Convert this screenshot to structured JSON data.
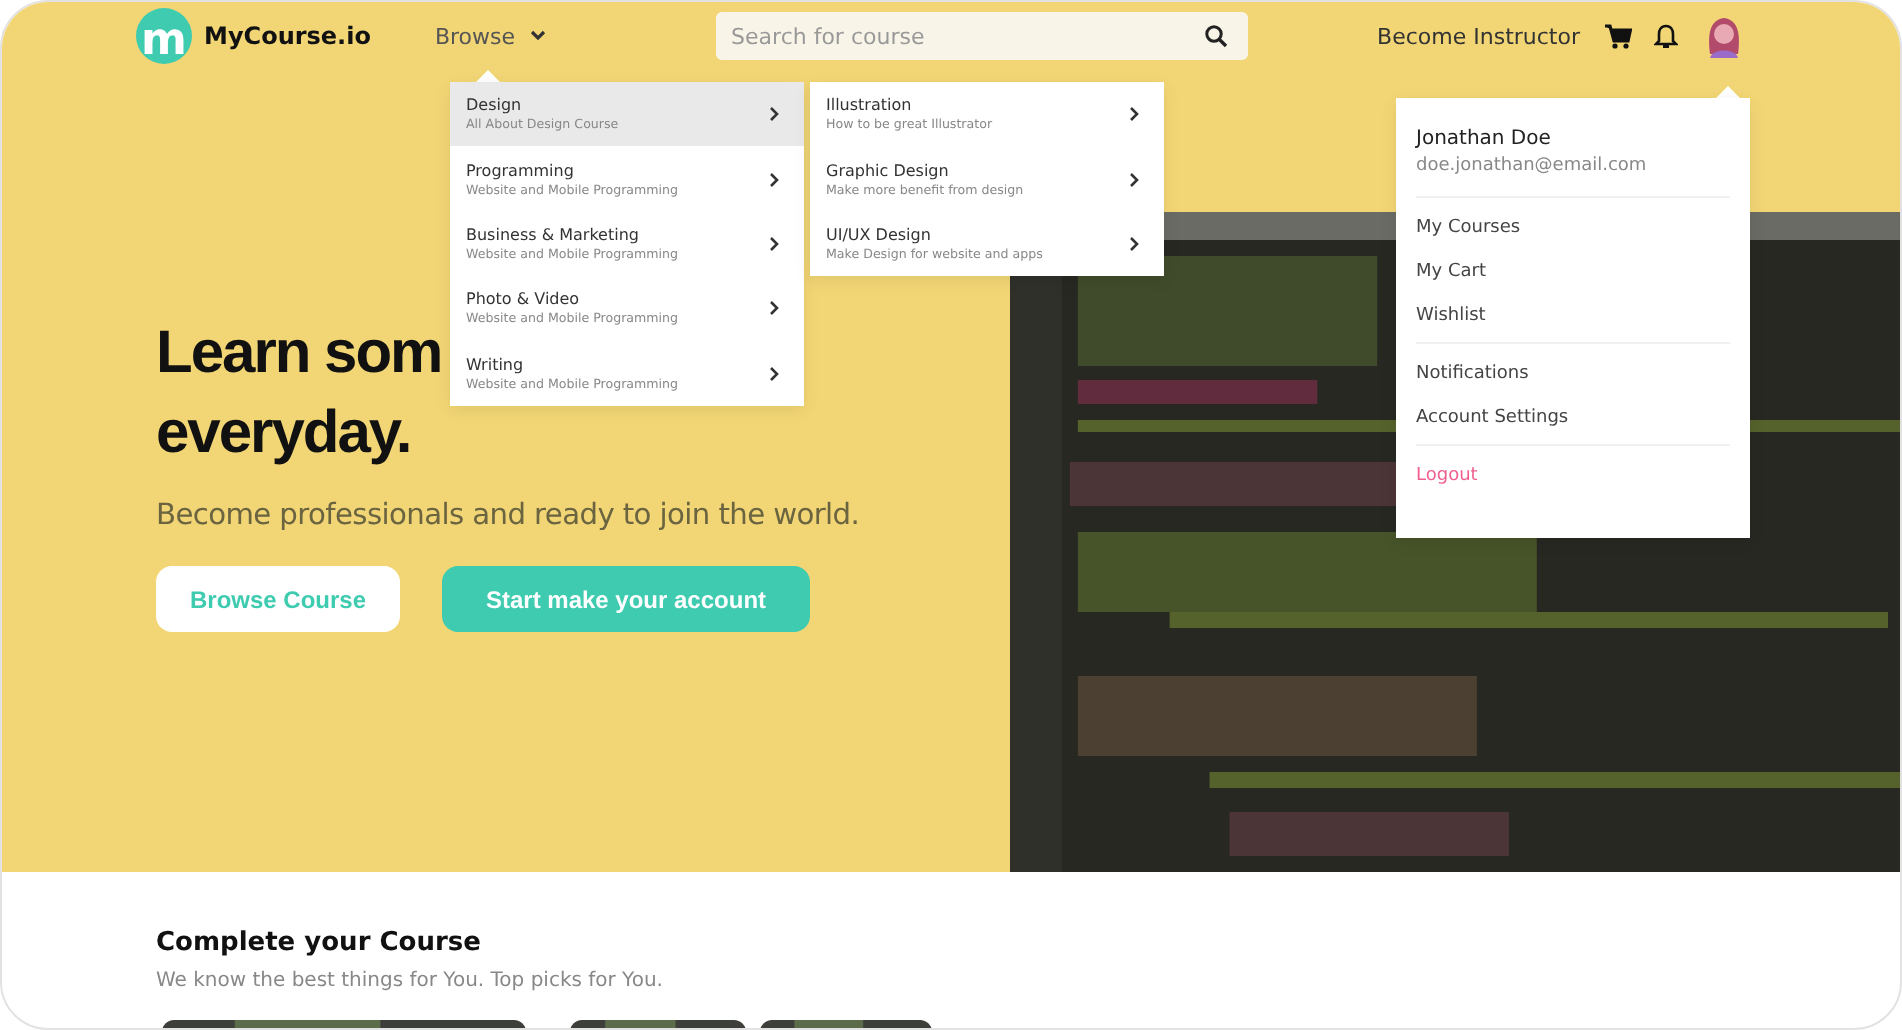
{
  "header": {
    "logo_mark": "m",
    "brand": "MyCourse.io",
    "browse": "Browse",
    "search": {
      "placeholder": "Search for course"
    },
    "become_instructor": "Become Instructor"
  },
  "browse_menu": [
    {
      "title": "Design",
      "subtitle": "All About Design Course",
      "selected": true
    },
    {
      "title": "Programming",
      "subtitle": "Website and Mobile Programming",
      "selected": false
    },
    {
      "title": "Business & Marketing",
      "subtitle": "Website and Mobile Programming",
      "selected": false
    },
    {
      "title": "Photo & Video",
      "subtitle": "Website and Mobile Programming",
      "selected": false
    },
    {
      "title": "Writing",
      "subtitle": "Website and Mobile Programming",
      "selected": false
    }
  ],
  "submenu": [
    {
      "title": "Illustration",
      "subtitle": "How to be great Illustrator"
    },
    {
      "title": "Graphic Design",
      "subtitle": "Make more benefit from design"
    },
    {
      "title": "UI/UX Design",
      "subtitle": "Make Design for website and apps"
    }
  ],
  "profile_menu": {
    "name": "Jonathan Doe",
    "email": "doe.jonathan@email.com",
    "groups": [
      [
        {
          "label": "My Courses",
          "kind": "normal"
        },
        {
          "label": "My Cart",
          "kind": "normal"
        },
        {
          "label": "Wishlist",
          "kind": "normal"
        }
      ],
      [
        {
          "label": "Notifications",
          "kind": "normal"
        },
        {
          "label": "Account Settings",
          "kind": "normal"
        }
      ],
      [
        {
          "label": "Logout",
          "kind": "danger"
        }
      ]
    ]
  },
  "hero": {
    "title_lines": [
      "Learn som",
      "everyday."
    ],
    "subtitle": "Become professionals and ready to join the world.",
    "buttons": [
      {
        "label": "Browse Course",
        "kind": "secondary"
      },
      {
        "label": "Start make your account",
        "kind": "primary"
      }
    ],
    "image": {
      "kind": "picture"
    }
  },
  "section": {
    "title": "Complete your Course",
    "subtitle": "We know the best things for You.  Top picks for You.",
    "cards": [
      {
        "kind": "picture"
      },
      {
        "kind": "picture"
      },
      {
        "kind": "picture"
      }
    ]
  }
}
